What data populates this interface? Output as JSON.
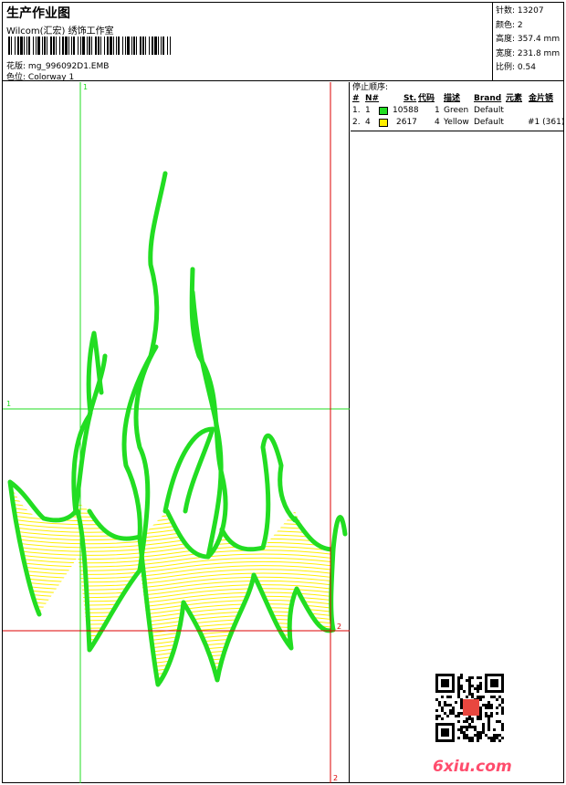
{
  "header": {
    "title": "生产作业图",
    "company": "Wilcom(汇宏) 绣饰工作室",
    "file_label": "花版:",
    "file_value": "mg_996092D1.EMB",
    "colorway_label": "色位:",
    "colorway_value": "Colorway 1"
  },
  "stats": [
    {
      "label": "针数:",
      "value": "13207"
    },
    {
      "label": "颜色:",
      "value": "2"
    },
    {
      "label": "高度:",
      "value": "357.4 mm"
    },
    {
      "label": "宽度:",
      "value": "231.8 mm"
    },
    {
      "label": "比例:",
      "value": "0.54"
    }
  ],
  "sequence": {
    "title": "停止顺序:",
    "columns": [
      "#",
      "N#",
      "St.",
      "代码",
      "描述",
      "Brand",
      "元素",
      "金片锈"
    ],
    "rows": [
      {
        "idx": "1.",
        "n": "1",
        "color": "#22dd22",
        "st": "10588",
        "code": "1",
        "desc": "Green",
        "brand": "Default",
        "element": "",
        "sequin": ""
      },
      {
        "idx": "2.",
        "n": "4",
        "color": "#ffee00",
        "st": "2617",
        "code": "4",
        "desc": "Yellow",
        "brand": "Default",
        "element": "",
        "sequin": "#1 (361)"
      }
    ]
  },
  "guides": {
    "green_label": "1",
    "red_label": "2"
  },
  "colors": {
    "green": "#22dd22",
    "yellow": "#ffee00",
    "red_guide": "#dd0000",
    "brand": "#ff4d6d"
  },
  "watermark": "6xiu.com"
}
